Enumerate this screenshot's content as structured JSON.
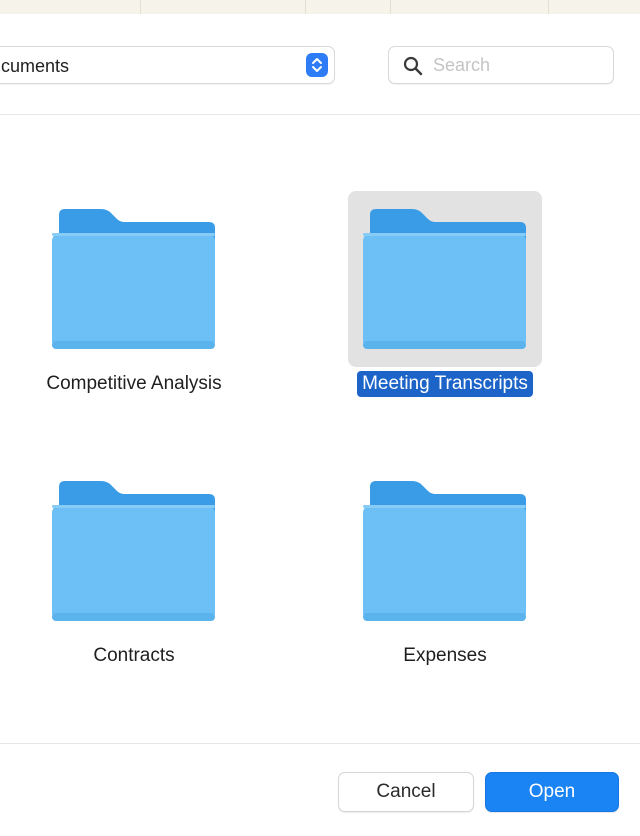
{
  "toolbar": {
    "location_label": "cuments",
    "search_placeholder": "Search",
    "search_value": ""
  },
  "folders": [
    {
      "name": "Competitive Analysis",
      "selected": false,
      "icon": "folder-icon"
    },
    {
      "name": "Meeting Transcripts",
      "selected": true,
      "icon": "folder-icon"
    },
    {
      "name": "Contracts",
      "selected": false,
      "icon": "folder-icon"
    },
    {
      "name": "Expenses",
      "selected": false,
      "icon": "folder-icon"
    }
  ],
  "buttons": {
    "cancel_label": "Cancel",
    "open_label": "Open"
  },
  "colors": {
    "accent": "#1a84f4",
    "selection": "#1d64c8",
    "folder_body": "#6cc0f5",
    "folder_tab": "#3a9be6"
  }
}
